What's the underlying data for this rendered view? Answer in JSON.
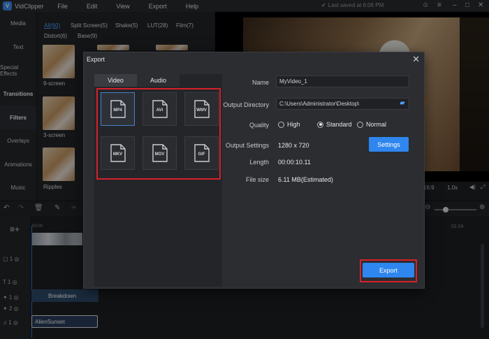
{
  "app": {
    "name": "VidClipper",
    "menu": [
      "File",
      "Edit",
      "View",
      "Export",
      "Help"
    ],
    "saved_status": "Last saved at 6:06 PM"
  },
  "leftnav": {
    "items": [
      "Media",
      "Text",
      "Special Effects",
      "Transitions",
      "Filters",
      "Overlays",
      "Animations",
      "Music"
    ],
    "active": "Filters"
  },
  "filters": {
    "tabs_row1": [
      "All(60)",
      "Split Screen(5)",
      "Shake(5)",
      "LUT(28)",
      "Film(7)"
    ],
    "tabs_row2": [
      "Distort(6)",
      "Base(9)"
    ],
    "thumb_labels": [
      "9-screen",
      "3-screen",
      "Ripples"
    ]
  },
  "preview": {
    "ratio": "16:9",
    "speed": "1.0x"
  },
  "timeline": {
    "ruler_start": "00:00",
    "ruler_mark": "01:04",
    "clips": {
      "overlay": "Breakdown",
      "music": "AlienSunset"
    }
  },
  "dialog": {
    "title": "Export",
    "tabs": [
      "Video",
      "Audio"
    ],
    "formats": [
      "MP4",
      "AVI",
      "WMV",
      "MKV",
      "MOV",
      "GIF"
    ],
    "selected_format": "MP4",
    "fields": {
      "name_label": "Name",
      "name_value": "MyVideo_1",
      "dir_label": "Output Directory",
      "dir_value": "C:\\Users\\Administrator\\Desktop\\",
      "quality_label": "Quality",
      "quality_options": [
        "High",
        "Standard",
        "Normal"
      ],
      "quality_selected": "Standard",
      "settings_label": "Output Settings",
      "settings_value": "1280 x 720",
      "settings_button": "Settings",
      "length_label": "Length",
      "length_value": "00:00:10.11",
      "size_label": "File size",
      "size_value": "6.11 MB(Estimated)"
    },
    "export_button": "Export"
  },
  "colors": {
    "accent": "#2e86ee",
    "highlight_box": "#d6202b"
  }
}
